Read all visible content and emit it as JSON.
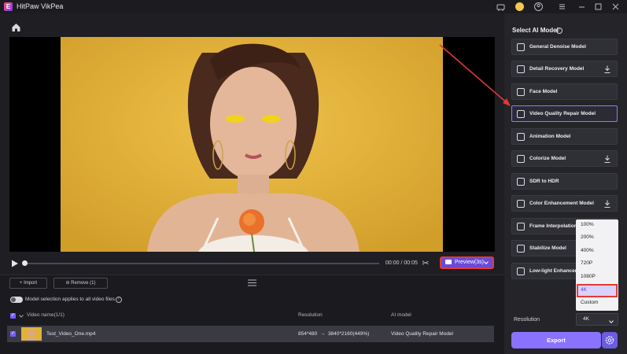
{
  "app": {
    "title": "HitPaw VikPea",
    "logo_letter": "E"
  },
  "player": {
    "time": "00:00 / 00:05",
    "preview_label": "Preview(3s)"
  },
  "file_panel": {
    "import_label": "Import",
    "remove_label": "Remove (1)",
    "toggle_label": "Model selection applies to all video files",
    "headers": {
      "name": "Video name(1/1)",
      "resolution": "Resolution",
      "ai_model": "AI model"
    },
    "rows": [
      {
        "name": "Test_Video_One.mp4",
        "resolution": "854*480  →  3840*2160(449%)",
        "ai_model": "Video Quality Repair Model"
      }
    ]
  },
  "right_panel": {
    "title": "Select AI Model",
    "models": [
      {
        "label": "General Denoise Model",
        "download": false
      },
      {
        "label": "Detail Recovery Model",
        "download": true
      },
      {
        "label": "Face Model",
        "download": false
      },
      {
        "label": "Video Quality Repair Model",
        "download": false,
        "selected": true
      },
      {
        "label": "Animation Model",
        "download": false
      },
      {
        "label": "Colorize Model",
        "download": true
      },
      {
        "label": "SDR to HDR",
        "download": false
      },
      {
        "label": "Color Enhancement Model",
        "download": true
      },
      {
        "label": "Frame Interpolation",
        "download": false
      },
      {
        "label": "Stabilize Model",
        "download": false
      },
      {
        "label": "Low-light Enhancem",
        "download": false
      }
    ],
    "resolution_label": "Resolution",
    "resolution_value": "4K",
    "resolution_options": [
      "100%",
      "200%",
      "400%",
      "720P",
      "1080P",
      "4K",
      "Custom"
    ],
    "export_label": "Export"
  },
  "colors": {
    "accent": "#8a72ff",
    "highlight": "#e53935",
    "video_bg": "#e0b23a"
  },
  "icons": [
    "home-icon",
    "play-icon",
    "scissors-icon",
    "camera-icon",
    "chevron-down-icon",
    "menu-icon",
    "info-icon",
    "download-icon",
    "gear-icon",
    "minimize-icon",
    "maximize-icon",
    "close-icon",
    "cart-icon",
    "user-icon"
  ]
}
